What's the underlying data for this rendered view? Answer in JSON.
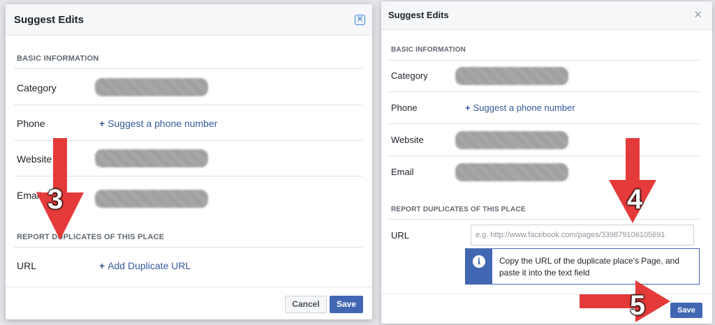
{
  "left_dialog": {
    "title": "Suggest Edits",
    "close_icon": "close-icon",
    "section_basic": "BASIC INFORMATION",
    "rows": {
      "category": "Category",
      "phone": "Phone",
      "website": "Website",
      "email": "Email"
    },
    "phone_link": "Suggest a phone number",
    "section_duplicates": "REPORT DUPLICATES OF THIS PLACE",
    "url_label": "URL",
    "add_duplicate_link": "Add Duplicate URL",
    "cancel_label": "Cancel",
    "save_label": "Save"
  },
  "right_dialog": {
    "title": "Suggest Edits",
    "close_icon": "close-icon",
    "section_basic": "BASIC INFORMATION",
    "rows": {
      "category": "Category",
      "phone": "Phone",
      "website": "Website",
      "email": "Email"
    },
    "phone_link": "Suggest a phone number",
    "section_duplicates": "REPORT DUPLICATES OF THIS PLACE",
    "url_label": "URL",
    "url_placeholder": "e.g. http://www.facebook.com/pages/339879106105691",
    "tip_text": "Copy the URL of the duplicate place's Page, and paste it into the text field",
    "tip_icon": "info-icon",
    "save_label": "Save"
  },
  "annotations": {
    "step3": "3",
    "step4": "4",
    "step5": "5",
    "arrow_color": "#e43a3a"
  }
}
